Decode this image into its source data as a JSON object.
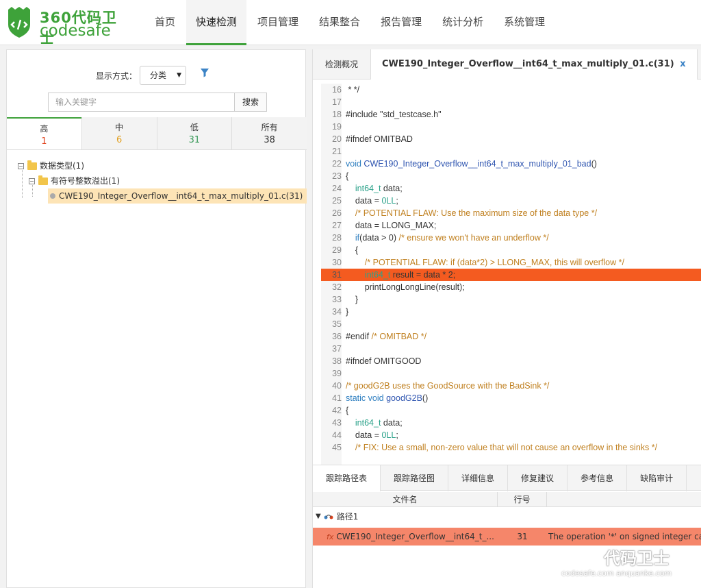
{
  "brand": {
    "cn": "360代码卫士",
    "en": "codesafe"
  },
  "nav": [
    "首页",
    "快速检测",
    "项目管理",
    "结果整合",
    "报告管理",
    "统计分析",
    "系统管理"
  ],
  "left": {
    "display_label": "显示方式：",
    "display_value": "分类",
    "search_placeholder": "输入关键字",
    "search_button": "搜索",
    "severity": [
      {
        "name": "高",
        "count": "1",
        "color": "#e0401a"
      },
      {
        "name": "中",
        "count": "6",
        "color": "#e2a020"
      },
      {
        "name": "低",
        "count": "31",
        "color": "#3a9a5a"
      },
      {
        "name": "所有",
        "count": "38",
        "color": "#333333"
      }
    ],
    "tree": {
      "root": "数据类型(1)",
      "child": "有符号整数溢出(1)",
      "leaf": "CWE190_Integer_Overflow__int64_t_max_multiply_01.c(31)"
    }
  },
  "right": {
    "tabs": {
      "overview": "检测概况",
      "file": "CWE190_Integer_Overflow__int64_t_max_multiply_01.c(31)",
      "close": "x"
    },
    "bottom_tabs": [
      "跟踪路径表",
      "跟踪路径图",
      "详细信息",
      "修复建议",
      "参考信息",
      "缺陷审计"
    ],
    "trace": {
      "col_file": "文件名",
      "col_line": "行号",
      "path_label": "路径1",
      "row_file": "CWE190_Integer_Overflow__int64_t_...",
      "row_line": "31",
      "row_msg": "The operation '*' on signed integer ca"
    }
  },
  "code_lines": [
    {
      "n": "16",
      "t": " * */"
    },
    {
      "n": "17",
      "t": ""
    },
    {
      "n": "18",
      "t": "#include \"std_testcase.h\""
    },
    {
      "n": "19",
      "t": ""
    },
    {
      "n": "20",
      "t": "#ifndef OMITBAD"
    },
    {
      "n": "21",
      "t": ""
    },
    {
      "n": "22",
      "t": "void CWE190_Integer_Overflow__int64_t_max_multiply_01_bad()"
    },
    {
      "n": "23",
      "t": "{"
    },
    {
      "n": "24",
      "t": "    int64_t data;"
    },
    {
      "n": "25",
      "t": "    data = 0LL;"
    },
    {
      "n": "26",
      "t": "    /* POTENTIAL FLAW: Use the maximum size of the data type */"
    },
    {
      "n": "27",
      "t": "    data = LLONG_MAX;"
    },
    {
      "n": "28",
      "t": "    if(data > 0) /* ensure we won't have an underflow */"
    },
    {
      "n": "29",
      "t": "    {"
    },
    {
      "n": "30",
      "t": "        /* POTENTIAL FLAW: if (data*2) > LLONG_MAX, this will overflow */"
    },
    {
      "n": "31",
      "t": "        int64_t result = data * 2;"
    },
    {
      "n": "32",
      "t": "        printLongLongLine(result);"
    },
    {
      "n": "33",
      "t": "    }"
    },
    {
      "n": "34",
      "t": "}"
    },
    {
      "n": "35",
      "t": ""
    },
    {
      "n": "36",
      "t": "#endif /* OMITBAD */"
    },
    {
      "n": "37",
      "t": ""
    },
    {
      "n": "38",
      "t": "#ifndef OMITGOOD"
    },
    {
      "n": "39",
      "t": ""
    },
    {
      "n": "40",
      "t": "/* goodG2B uses the GoodSource with the BadSink */"
    },
    {
      "n": "41",
      "t": "static void goodG2B()"
    },
    {
      "n": "42",
      "t": "{"
    },
    {
      "n": "43",
      "t": "    int64_t data;"
    },
    {
      "n": "44",
      "t": "    data = 0LL;"
    },
    {
      "n": "45",
      "t": "    /* FIX: Use a small, non-zero value that will not cause an overflow in the sinks */"
    }
  ],
  "highlight_line": "31",
  "watermark": {
    "text": "代码卫士",
    "sub": "codesafe.com  anquanke.com"
  }
}
